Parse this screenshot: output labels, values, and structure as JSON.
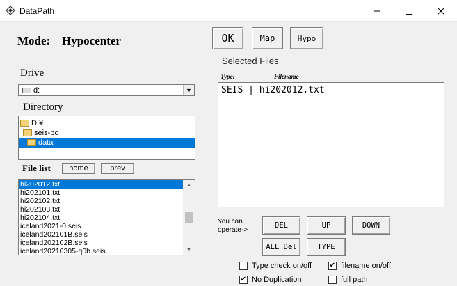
{
  "window": {
    "title": "DataPath",
    "minimize": "─",
    "maximize": "☐",
    "close": "✕"
  },
  "mode": {
    "label": "Mode:",
    "value": "Hypocenter"
  },
  "top_buttons": {
    "ok": "OK",
    "map": "Map",
    "hypo": "Hypo"
  },
  "drive": {
    "label": "Drive",
    "value": "d:",
    "arrow": "▼"
  },
  "directory": {
    "label": "Directory",
    "items": [
      {
        "label": "D:¥"
      },
      {
        "label": "seis-pc"
      },
      {
        "label": "data"
      }
    ]
  },
  "file_list": {
    "label": "File list",
    "home_label": "home",
    "prev_label": "prev",
    "items": [
      "hi202012.txt",
      "hi202101.txt",
      "hi202102.txt",
      "hi202103.txt",
      "hi202104.txt",
      "iceland2021-0.seis",
      "iceland202101B.seis",
      "iceland202102B.seis",
      "iceland20210305-q0b.seis"
    ],
    "selected_index": 0
  },
  "selected_files": {
    "title": "Selected Files",
    "col_type": "Type:",
    "col_filename": "Filename",
    "entries": [
      "SEIS | hi202012.txt"
    ]
  },
  "operate": {
    "text_line1": "You can",
    "text_line2": "operate->",
    "del": "DEL",
    "up": "UP",
    "down": "DOWN",
    "all_del": "ALL Del",
    "type": "TYPE"
  },
  "options": {
    "type_check": {
      "label": "Type check on/off",
      "checked": false
    },
    "filename": {
      "label": "filename on/off",
      "checked": true
    },
    "no_duplication": {
      "label": "No Duplication",
      "checked": true
    },
    "full_path": {
      "label": "full path",
      "checked": false
    }
  }
}
